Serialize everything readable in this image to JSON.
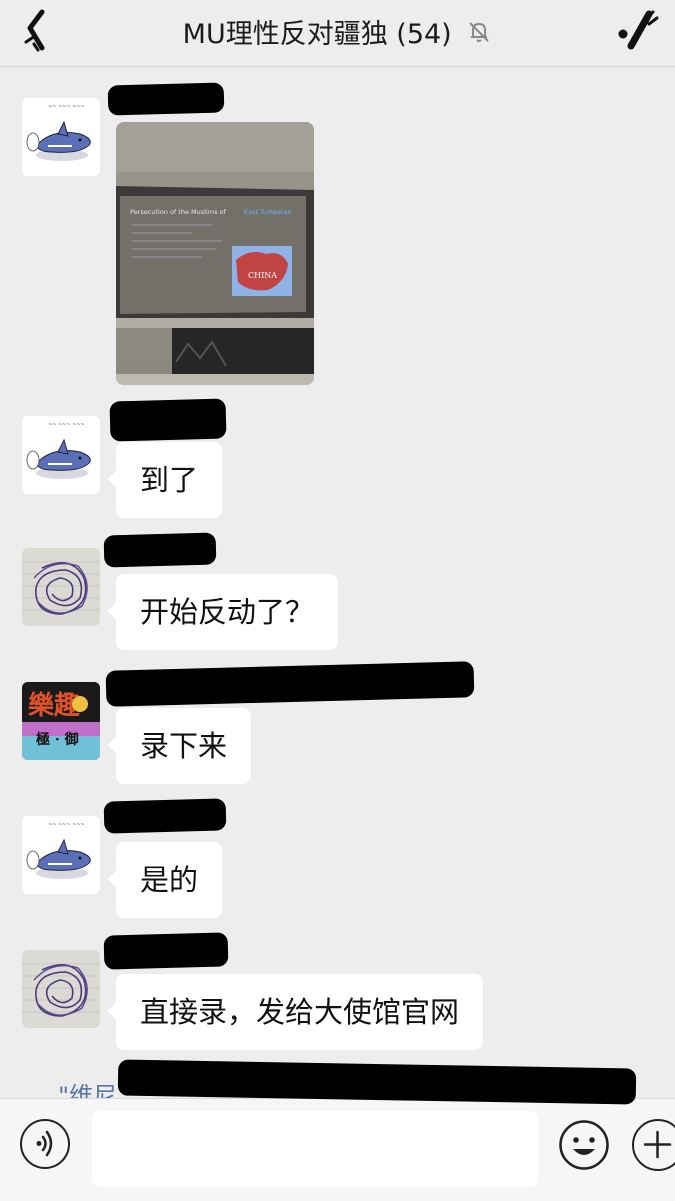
{
  "header": {
    "title": "MU理性反对疆独 (54)",
    "icons": {
      "back": "back-arrow-icon",
      "mute": "bell-muted-icon",
      "more": "more-icon"
    }
  },
  "messages": [
    {
      "type": "image",
      "avatar": "cartoon-shark-avatar",
      "name_redacted": true,
      "photo": {
        "slide_title": "Persecution of the Muslims of",
        "slide_title_highlight": "East Turkestan",
        "map_label": "CHINA"
      }
    },
    {
      "type": "text",
      "avatar": "cartoon-shark-avatar",
      "name_redacted": true,
      "text": "到了"
    },
    {
      "type": "text",
      "avatar": "purple-scribble-avatar",
      "name_redacted": true,
      "text": "开始反动了？"
    },
    {
      "type": "text",
      "avatar": "poster-avatar",
      "name_redacted": true,
      "text": "录下来",
      "avatar_text": {
        "top": "樂趣",
        "middle": "極 · 御"
      }
    },
    {
      "type": "text",
      "avatar": "cartoon-shark-avatar",
      "name_redacted": true,
      "text": "是的"
    },
    {
      "type": "text",
      "avatar": "purple-scribble-avatar",
      "name_redacted": true,
      "text": "直接录，发给大使馆官网"
    }
  ],
  "partial_name": "\"维尼",
  "input_bar": {
    "value": "",
    "icons": {
      "voice": "voice-icon",
      "emoji": "emoji-icon",
      "plus": "plus-icon"
    }
  },
  "colors": {
    "background": "#ededed",
    "bubble": "#ffffff",
    "name_link": "#5876a6"
  }
}
